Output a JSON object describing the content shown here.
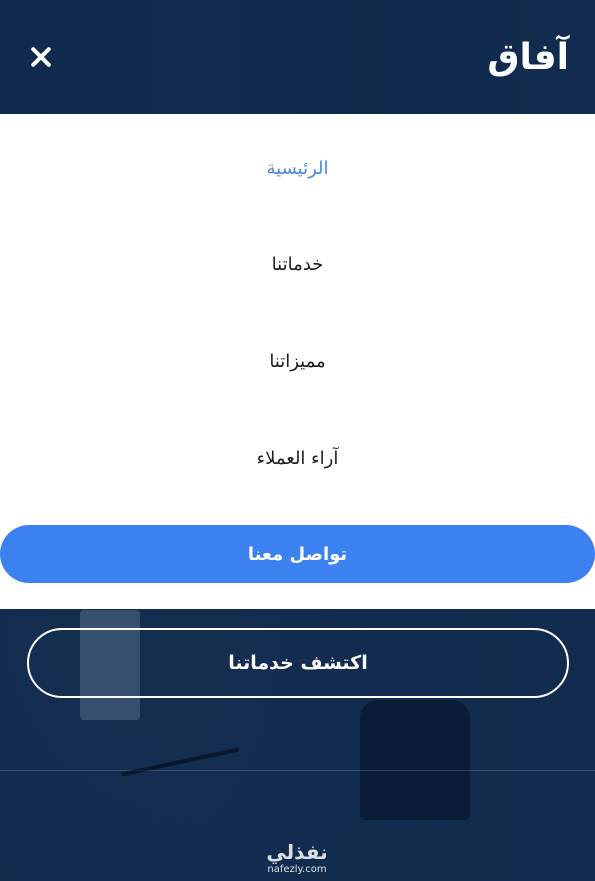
{
  "header": {
    "logo": "آفاق",
    "close_icon": "close-icon"
  },
  "menu": {
    "items": [
      {
        "label": "الرئيسية",
        "active": true
      },
      {
        "label": "خدماتنا",
        "active": false
      },
      {
        "label": "مميزاتنا",
        "active": false
      },
      {
        "label": "آراء العملاء",
        "active": false
      }
    ],
    "contact_button": "تواصل معنا"
  },
  "hero": {
    "discover_button": "اكتشف خدماتنا"
  },
  "watermark": {
    "arabic": "نفذلي",
    "latin": "nafezly.com"
  },
  "colors": {
    "accent": "#3b82f0",
    "active_link": "#4a8ad8",
    "overlay": "#0f2a4d"
  }
}
